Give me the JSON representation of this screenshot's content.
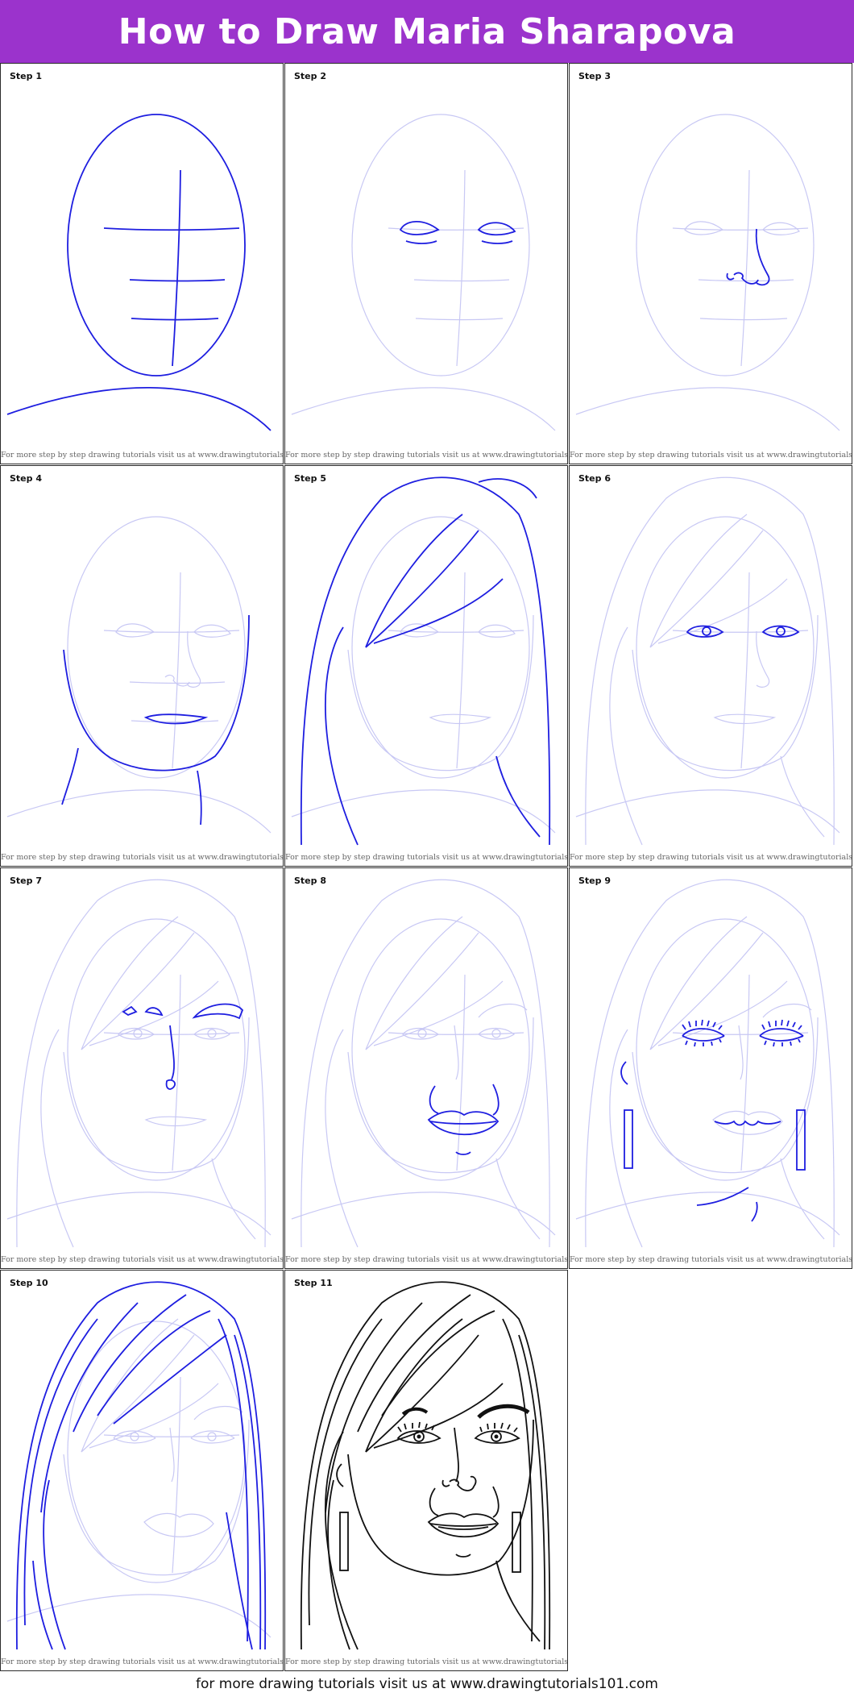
{
  "title": "How to Draw Maria Sharapova",
  "credit": "For more step by step drawing tutorials visit us at www.drawingtutorials101.com",
  "footer": "for more drawing tutorials visit us at www.drawingtutorials101.com",
  "steps": [
    {
      "label": "Step 1"
    },
    {
      "label": "Step 2"
    },
    {
      "label": "Step 3"
    },
    {
      "label": "Step 4"
    },
    {
      "label": "Step 5"
    },
    {
      "label": "Step 6"
    },
    {
      "label": "Step 7"
    },
    {
      "label": "Step 8"
    },
    {
      "label": "Step 9"
    },
    {
      "label": "Step 10"
    },
    {
      "label": "Step 11"
    }
  ],
  "colors": {
    "header": "#9b33cc",
    "new_lines": "#1e1ee0",
    "guide_lines": "#c8c8f4",
    "final_lines": "#111111"
  }
}
